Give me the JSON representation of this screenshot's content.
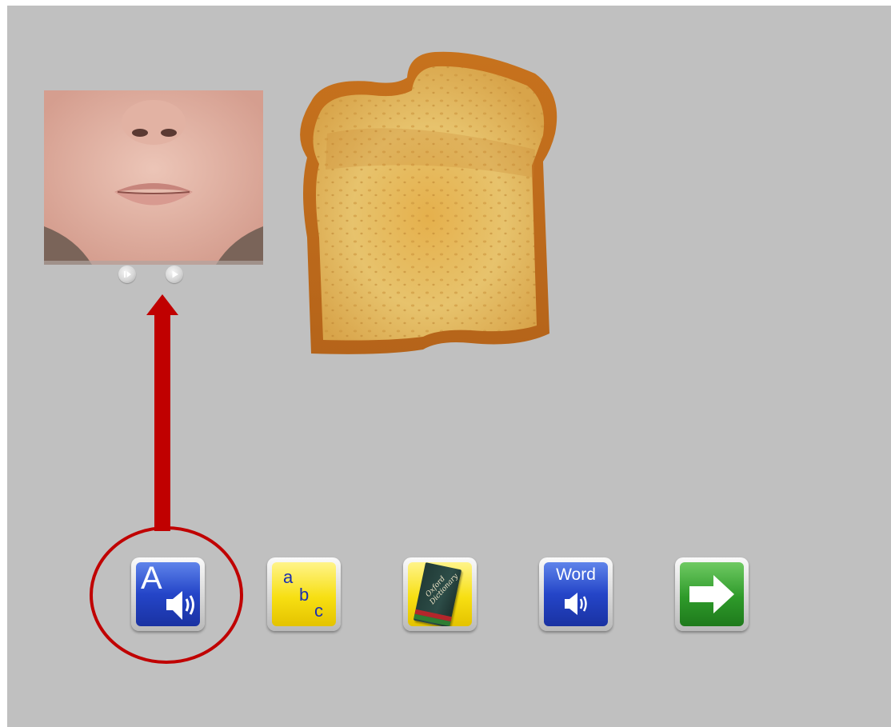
{
  "toolbar": {
    "read_aloud": {
      "letter": "A",
      "icon": "speaker-icon"
    },
    "alphabet": {
      "letters": [
        "a",
        "b",
        "c"
      ]
    },
    "dictionary": {
      "cover_title": "Oxford Dictionary",
      "icon": "book-icon"
    },
    "word": {
      "label": "Word",
      "icon": "speaker-icon"
    },
    "next": {
      "icon": "arrow-right-icon"
    }
  },
  "video": {
    "controls": [
      "step-forward-icon",
      "play-icon"
    ]
  },
  "colors": {
    "background": "#c0c0c0",
    "annotation_red": "#c00000",
    "button_blue": "#2445c8",
    "button_yellow": "#f7df12",
    "button_green": "#2e9a2a"
  }
}
